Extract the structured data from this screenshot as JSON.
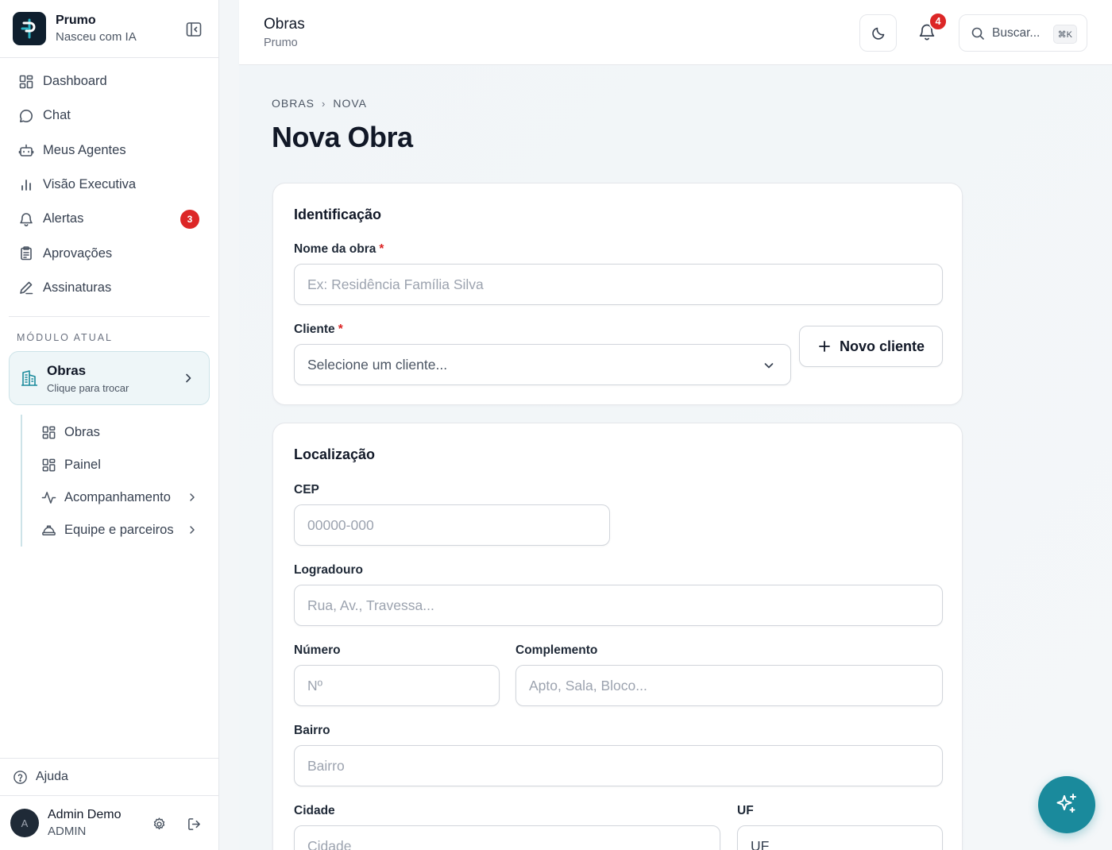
{
  "brand": {
    "name": "Prumo",
    "tagline": "Nasceu com IA"
  },
  "nav": [
    {
      "label": "Dashboard",
      "icon": "grid-icon"
    },
    {
      "label": "Chat",
      "icon": "chat-bubble-icon"
    },
    {
      "label": "Meus Agentes",
      "icon": "bot-icon"
    },
    {
      "label": "Visão Executiva",
      "icon": "bar-chart-icon"
    },
    {
      "label": "Alertas",
      "icon": "bell-icon",
      "badge": "3"
    },
    {
      "label": "Aprovações",
      "icon": "clipboard-icon"
    },
    {
      "label": "Assinaturas",
      "icon": "pen-icon"
    }
  ],
  "module": {
    "section_label": "MÓDULO ATUAL",
    "title": "Obras",
    "subtitle": "Clique para trocar"
  },
  "subnav": [
    {
      "label": "Obras",
      "icon": "grid-icon"
    },
    {
      "label": "Painel",
      "icon": "grid-icon"
    },
    {
      "label": "Acompanhamento",
      "icon": "activity-icon"
    },
    {
      "label": "Equipe e parceiros",
      "icon": "hard-hat-icon"
    }
  ],
  "help": {
    "label": "Ajuda"
  },
  "user": {
    "initial": "A",
    "name": "Admin Demo",
    "role": "ADMIN"
  },
  "header": {
    "title": "Obras",
    "subtitle": "Prumo",
    "notifications": "4",
    "search_placeholder": "Buscar...",
    "search_shortcut": "⌘K"
  },
  "breadcrumb": {
    "parent": "OBRAS",
    "current": "NOVA"
  },
  "page_title": "Nova Obra",
  "identificacao": {
    "title": "Identificação",
    "nome_label": "Nome da obra",
    "nome_placeholder": "Ex: Residência Família Silva",
    "cliente_label": "Cliente",
    "cliente_placeholder": "Selecione um cliente...",
    "novo_cliente": "Novo cliente",
    "required_mark": "*"
  },
  "localizacao": {
    "title": "Localização",
    "cep_label": "CEP",
    "cep_placeholder": "00000-000",
    "logradouro_label": "Logradouro",
    "logradouro_placeholder": "Rua, Av., Travessa...",
    "numero_label": "Número",
    "numero_placeholder": "Nº",
    "complemento_label": "Complemento",
    "complemento_placeholder": "Apto, Sala, Bloco...",
    "bairro_label": "Bairro",
    "bairro_placeholder": "Bairro",
    "cidade_label": "Cidade",
    "cidade_placeholder": "Cidade",
    "uf_label": "UF",
    "uf_placeholder": "UF"
  },
  "colors": {
    "accent": "#1a8a9c",
    "badge": "#dc2626",
    "dark": "#0f1f2e"
  }
}
